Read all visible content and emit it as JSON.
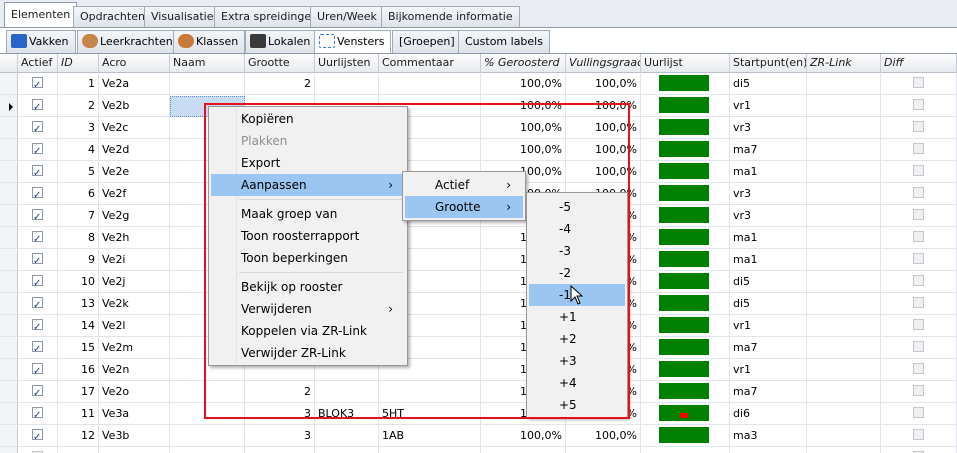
{
  "tabs_top": [
    "Elementen",
    "Opdrachten",
    "Visualisatie",
    "Extra spreidingen",
    "Uren/Week",
    "Bijkomende informatie"
  ],
  "tabs_sub": [
    {
      "label": "Vakken",
      "icon": "books-icon",
      "color": "#2a64c8"
    },
    {
      "label": "Leerkrachten",
      "icon": "teacher-icon",
      "color": "#c8874a"
    },
    {
      "label": "Klassen",
      "icon": "class-icon",
      "color": "#c87a3a"
    },
    {
      "label": "Lokalen",
      "icon": "room-icon",
      "color": "#3a3a3a"
    },
    {
      "label": "Vensters",
      "icon": "window-icon",
      "color": "#3a78d8"
    },
    {
      "label": "[Groepen]",
      "icon": "",
      "color": ""
    },
    {
      "label": "Custom labels",
      "icon": "",
      "color": ""
    }
  ],
  "columns": [
    "Actief",
    "ID",
    "Acro",
    "Naam",
    "Grootte",
    "Uurlijsten",
    "Commentaar",
    "% Geroosterd",
    "Vullingsgraad",
    "Uurlijst",
    "Startpunt(en)",
    "ZR-Link",
    "Diff"
  ],
  "rows": [
    {
      "id": "1",
      "acro": "Ve2a",
      "naam": "",
      "grootte": "2",
      "uurlijsten": "",
      "commentaar": "",
      "geroosterd": "100,0%",
      "vulling": "100,0%",
      "start": "di5",
      "redmark": false
    },
    {
      "id": "2",
      "acro": "Ve2b",
      "naam": "",
      "grootte": "",
      "uurlijsten": "",
      "commentaar": "",
      "geroosterd": "100,0%",
      "vulling": "100,0%",
      "start": "vr1",
      "redmark": false
    },
    {
      "id": "3",
      "acro": "Ve2c",
      "naam": "",
      "grootte": "",
      "uurlijsten": "",
      "commentaar": "",
      "geroosterd": "100,0%",
      "vulling": "100,0%",
      "start": "vr3",
      "redmark": false
    },
    {
      "id": "4",
      "acro": "Ve2d",
      "naam": "",
      "grootte": "",
      "uurlijsten": "",
      "commentaar": "",
      "geroosterd": "100,0%",
      "vulling": "100,0%",
      "start": "ma7",
      "redmark": false
    },
    {
      "id": "5",
      "acro": "Ve2e",
      "naam": "",
      "grootte": "",
      "uurlijsten": "",
      "commentaar": "",
      "geroosterd": "100,0%",
      "vulling": "100,0%",
      "start": "ma1",
      "redmark": false
    },
    {
      "id": "6",
      "acro": "Ve2f",
      "naam": "",
      "grootte": "",
      "uurlijsten": "",
      "commentaar": "",
      "geroosterd": "100,0%",
      "vulling": "100,0%",
      "start": "vr3",
      "redmark": false
    },
    {
      "id": "7",
      "acro": "Ve2g",
      "naam": "",
      "grootte": "",
      "uurlijsten": "",
      "commentaar": "",
      "geroosterd": "100,0%",
      "vulling": "100,0%",
      "start": "vr3",
      "redmark": false
    },
    {
      "id": "8",
      "acro": "Ve2h",
      "naam": "",
      "grootte": "",
      "uurlijsten": "",
      "commentaar": "",
      "geroosterd": "100,0%",
      "vulling": "100,0%",
      "start": "ma1",
      "redmark": false
    },
    {
      "id": "9",
      "acro": "Ve2i",
      "naam": "",
      "grootte": "",
      "uurlijsten": "",
      "commentaar": "",
      "geroosterd": "100,0%",
      "vulling": "100,0%",
      "start": "ma1",
      "redmark": false
    },
    {
      "id": "10",
      "acro": "Ve2j",
      "naam": "",
      "grootte": "",
      "uurlijsten": "",
      "commentaar": "",
      "geroosterd": "100,0%",
      "vulling": "100,0%",
      "start": "di5",
      "redmark": false
    },
    {
      "id": "13",
      "acro": "Ve2k",
      "naam": "",
      "grootte": "",
      "uurlijsten": "",
      "commentaar": "",
      "geroosterd": "100,0%",
      "vulling": "100,0%",
      "start": "di5",
      "redmark": false
    },
    {
      "id": "14",
      "acro": "Ve2l",
      "naam": "",
      "grootte": "",
      "uurlijsten": "",
      "commentaar": "",
      "geroosterd": "100,0%",
      "vulling": "100,0%",
      "start": "vr1",
      "redmark": false
    },
    {
      "id": "15",
      "acro": "Ve2m",
      "naam": "",
      "grootte": "",
      "uurlijsten": "",
      "commentaar": "",
      "geroosterd": "100,0%",
      "vulling": "100,0%",
      "start": "ma7",
      "redmark": false
    },
    {
      "id": "16",
      "acro": "Ve2n",
      "naam": "",
      "grootte": "",
      "uurlijsten": "",
      "commentaar": "",
      "geroosterd": "100,0%",
      "vulling": "100,0%",
      "start": "vr1",
      "redmark": false
    },
    {
      "id": "17",
      "acro": "Ve2o",
      "naam": "",
      "grootte": "2",
      "uurlijsten": "",
      "commentaar": "",
      "geroosterd": "100,0%",
      "vulling": "100,0%",
      "start": "ma7",
      "redmark": false
    },
    {
      "id": "11",
      "acro": "Ve3a",
      "naam": "",
      "grootte": "3",
      "uurlijsten": "BLOK3",
      "commentaar": "5HT",
      "geroosterd": "100,0%",
      "vulling": "100,0%",
      "start": "di6",
      "redmark": true
    },
    {
      "id": "12",
      "acro": "Ve3b",
      "naam": "",
      "grootte": "3",
      "uurlijsten": "",
      "commentaar": "1AB",
      "geroosterd": "100,0%",
      "vulling": "100,0%",
      "start": "ma3",
      "redmark": false
    }
  ],
  "new_row_marker": "*",
  "context_menu": {
    "items": [
      "Kopiëren",
      "Plakken",
      "Export",
      "Aanpassen",
      "Maak groep van",
      "Toon roosterrapport",
      "Toon beperkingen",
      "Bekijk op rooster",
      "Verwijderen",
      "Koppelen via ZR-Link",
      "Verwijder ZR-Link"
    ],
    "disabled": [
      "Plakken"
    ],
    "highlighted": "Aanpassen",
    "submenu_arrow": "›"
  },
  "submenu_aanpassen": {
    "items": [
      "Actief",
      "Grootte"
    ],
    "highlighted": "Grootte"
  },
  "submenu_grootte": {
    "items": [
      "-5",
      "-4",
      "-3",
      "-2",
      "-1",
      "+1",
      "+2",
      "+3",
      "+4",
      "+5"
    ],
    "highlighted": "-1"
  },
  "colors": {
    "bar": "#008000",
    "highlight": "#9bc6f1",
    "annotation": "#e8101a"
  }
}
